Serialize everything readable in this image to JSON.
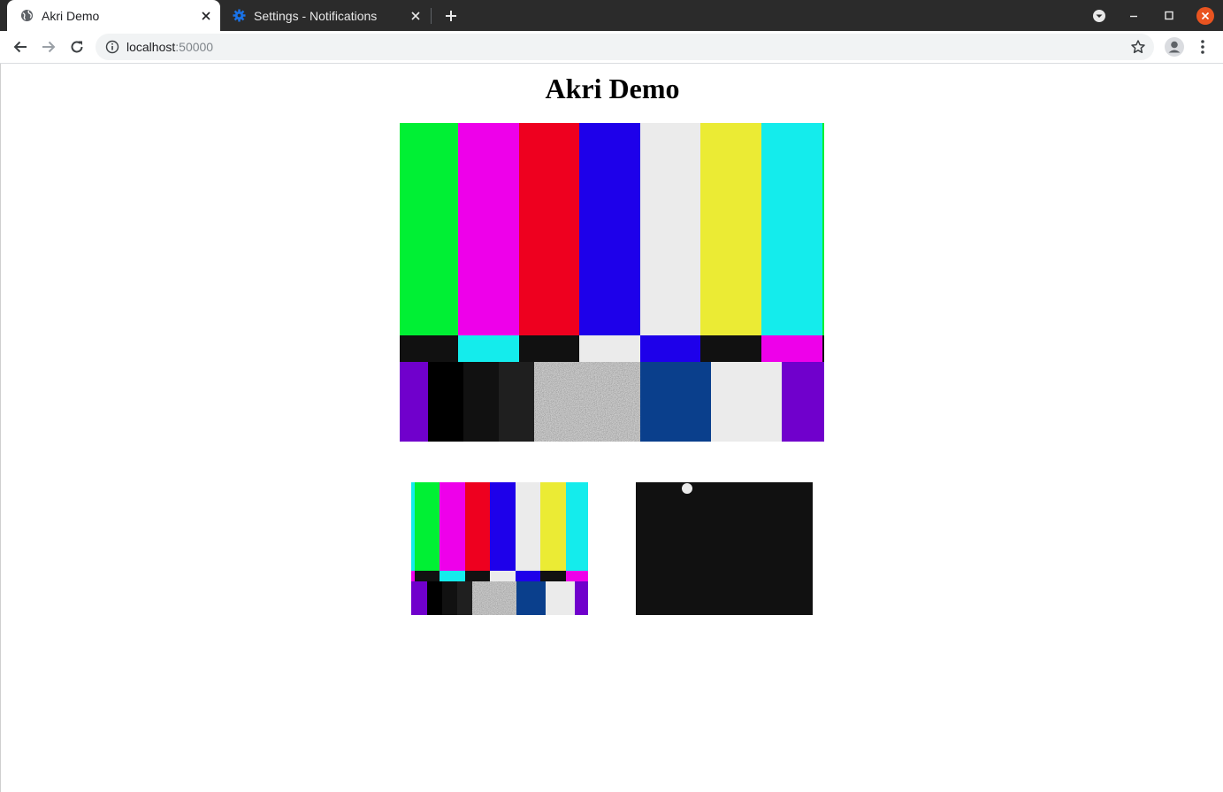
{
  "browser": {
    "tabs": [
      {
        "title": "Akri Demo",
        "icon": "globe-icon",
        "active": true
      },
      {
        "title": "Settings - Notifications",
        "icon": "gear-icon",
        "active": false
      }
    ],
    "url": {
      "host": "localhost",
      "port": ":50000"
    }
  },
  "page": {
    "title": "Akri Demo",
    "streams": [
      {
        "name": "main-stream",
        "content": "SMPTE color bars"
      },
      {
        "name": "small-stream-1",
        "content": "SMPTE color bars"
      },
      {
        "name": "small-stream-2",
        "content": "black frame with white ball"
      }
    ]
  },
  "colors": {
    "bars_top": [
      "#00f034",
      "#ee00ea",
      "#ee001f",
      "#1e00ea",
      "#ebebeb",
      "#ebeb34",
      "#14ecec"
    ],
    "bars_mid": [
      "#111111",
      "#14ecec",
      "#111111",
      "#ebebeb",
      "#1e00ea",
      "#111111",
      "#ee00ea"
    ],
    "bars_bottom": [
      "#7000cc",
      "#000000",
      "#111111",
      "#1f1f1f",
      "noise",
      "#0a3f8c",
      "#ebebeb",
      "#7000cc"
    ],
    "tabbar_bg": "#2b2b2b",
    "close_window_red": "#e95420"
  }
}
